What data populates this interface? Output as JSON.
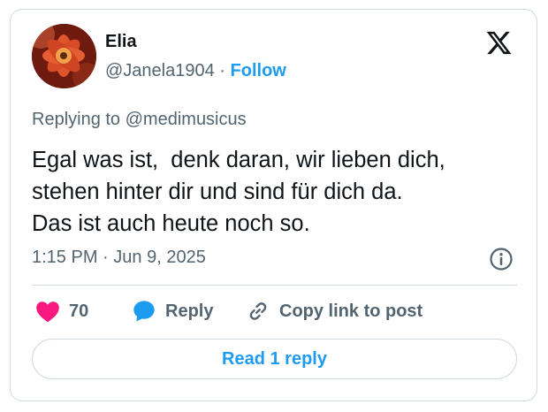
{
  "user": {
    "name": "Elia",
    "handle": "@Janela1904",
    "separator": "·",
    "follow_label": "Follow",
    "avatar_icon": "flower-avatar"
  },
  "brand": {
    "logo_icon": "x-logo-icon"
  },
  "reply_context": {
    "prefix": "Replying to ",
    "target": "@medimusicus"
  },
  "tweet": {
    "lines": [
      "Egal was ist,  denk daran, wir lieben dich,",
      "stehen hinter dir und sind für dich da.",
      "Das ist auch heute noch so."
    ],
    "time": "1:15 PM",
    "separator": "·",
    "date": "Jun 9, 2025"
  },
  "actions": {
    "like_count": "70",
    "reply_label": "Reply",
    "copy_label": "Copy link to post"
  },
  "footer": {
    "read_replies_label": "Read 1 reply"
  },
  "colors": {
    "accent": "#1d9bf0",
    "like": "#f91880",
    "secondary_text": "#536471",
    "primary_text": "#0f1419",
    "border": "#cfd9de"
  }
}
